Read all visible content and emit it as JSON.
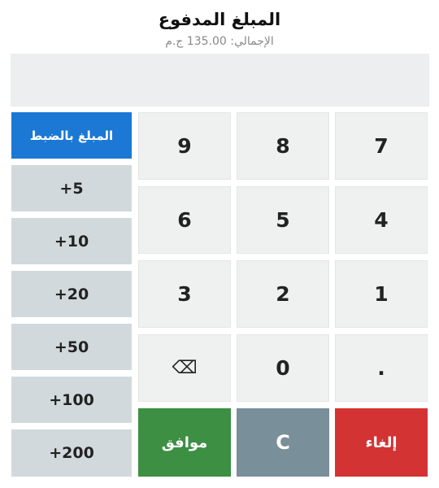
{
  "header": {
    "title": "المبلغ المدفوع",
    "total": "الإجمالي: 135.00 ج.م"
  },
  "display": {
    "value": ""
  },
  "keypad": {
    "k9": "9",
    "k8": "8",
    "k7": "7",
    "k6": "6",
    "k5": "5",
    "k4": "4",
    "k3": "3",
    "k2": "2",
    "k1": "1",
    "backspace": "⌫",
    "k0": "0",
    "dot": "."
  },
  "actions": {
    "ok": "موافق",
    "clear": "C",
    "cancel": "إلغاء"
  },
  "quick": {
    "exact": "المبلغ بالضبط",
    "p5": "+5",
    "p10": "+10",
    "p20": "+20",
    "p50": "+50",
    "p100": "+100",
    "p200": "+200"
  },
  "colors": {
    "accent": "#1b78d4",
    "ok": "#3c8f43",
    "clear": "#798f99",
    "cancel": "#d33333"
  }
}
